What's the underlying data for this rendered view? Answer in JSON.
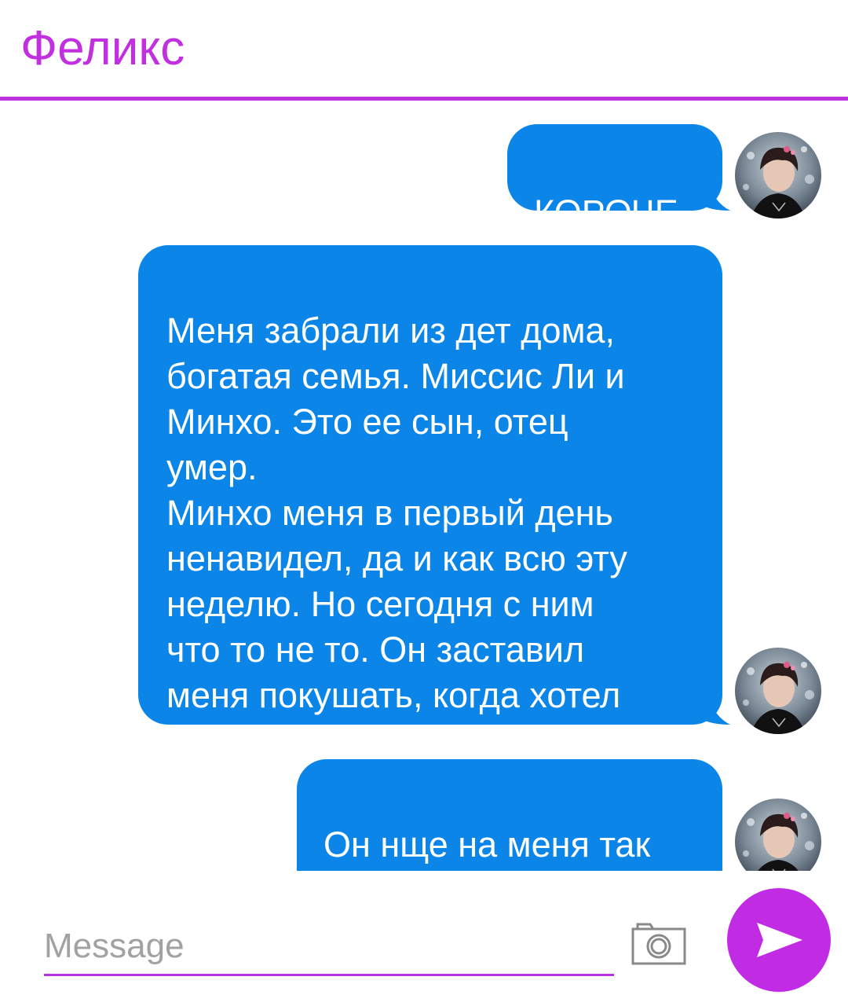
{
  "header": {
    "contact_name": "Феликс",
    "accent_color": "#c22fe0"
  },
  "messages": [
    {
      "text": "КОРОЧЕ",
      "sender": "me"
    },
    {
      "text": "Меня забрали из дет дома,\nбогатая семья. Миссис Ли и\nМинхо. Это ее сын, отец\nумер.\nМинхо меня в первый день\nненавидел, да и как всю эту\nнеделю. Но сегодня с ним\nчто то не то. Он заставил\nменя покушать, когда хотел\nнакричать, замолчал и тд ..",
      "sender": "me"
    },
    {
      "text": "Он нще на меня так\nсмотрит..",
      "sender": "me"
    }
  ],
  "bubble_color": "#0b86e8",
  "composer": {
    "placeholder": "Message",
    "camera_icon": "camera-icon",
    "send_icon": "send-icon"
  }
}
